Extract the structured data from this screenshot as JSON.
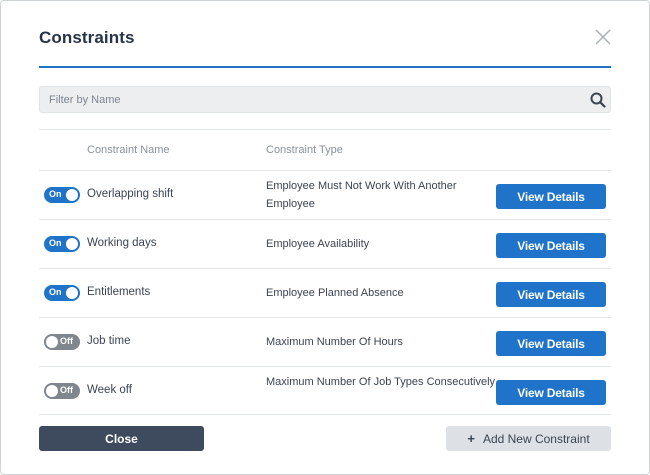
{
  "dialog": {
    "title": "Constraints",
    "close_icon": "close-icon"
  },
  "filter": {
    "placeholder": "Filter by Name",
    "value": "",
    "icon": "search-icon"
  },
  "table": {
    "headers": {
      "name": "Constraint Name",
      "type": "Constraint Type"
    },
    "rows": [
      {
        "enabled": true,
        "toggle_label": "On",
        "name": "Overlapping shift",
        "type": "Employee Must Not Work With Another Employee",
        "button": "View Details"
      },
      {
        "enabled": true,
        "toggle_label": "On",
        "name": "Working days",
        "type": "Employee Availability",
        "button": "View Details"
      },
      {
        "enabled": true,
        "toggle_label": "On",
        "name": "Entitlements",
        "type": "Employee Planned Absence",
        "button": "View Details"
      },
      {
        "enabled": false,
        "toggle_label": "Off",
        "name": "Job time",
        "type": "Maximum Number Of Hours",
        "button": "View Details"
      },
      {
        "enabled": false,
        "toggle_label": "Off",
        "name": "Week off",
        "type": "Maximum Number Of Job Types Consecutively",
        "button": "View Details"
      }
    ]
  },
  "footer": {
    "close_label": "Close",
    "add_label": "Add New Constraint",
    "add_icon": "plus-icon"
  },
  "colors": {
    "accent": "#1f73c8",
    "toggle_off": "#7f868e",
    "close_button": "#3e4b5e",
    "secondary_button": "#dde1e5"
  }
}
